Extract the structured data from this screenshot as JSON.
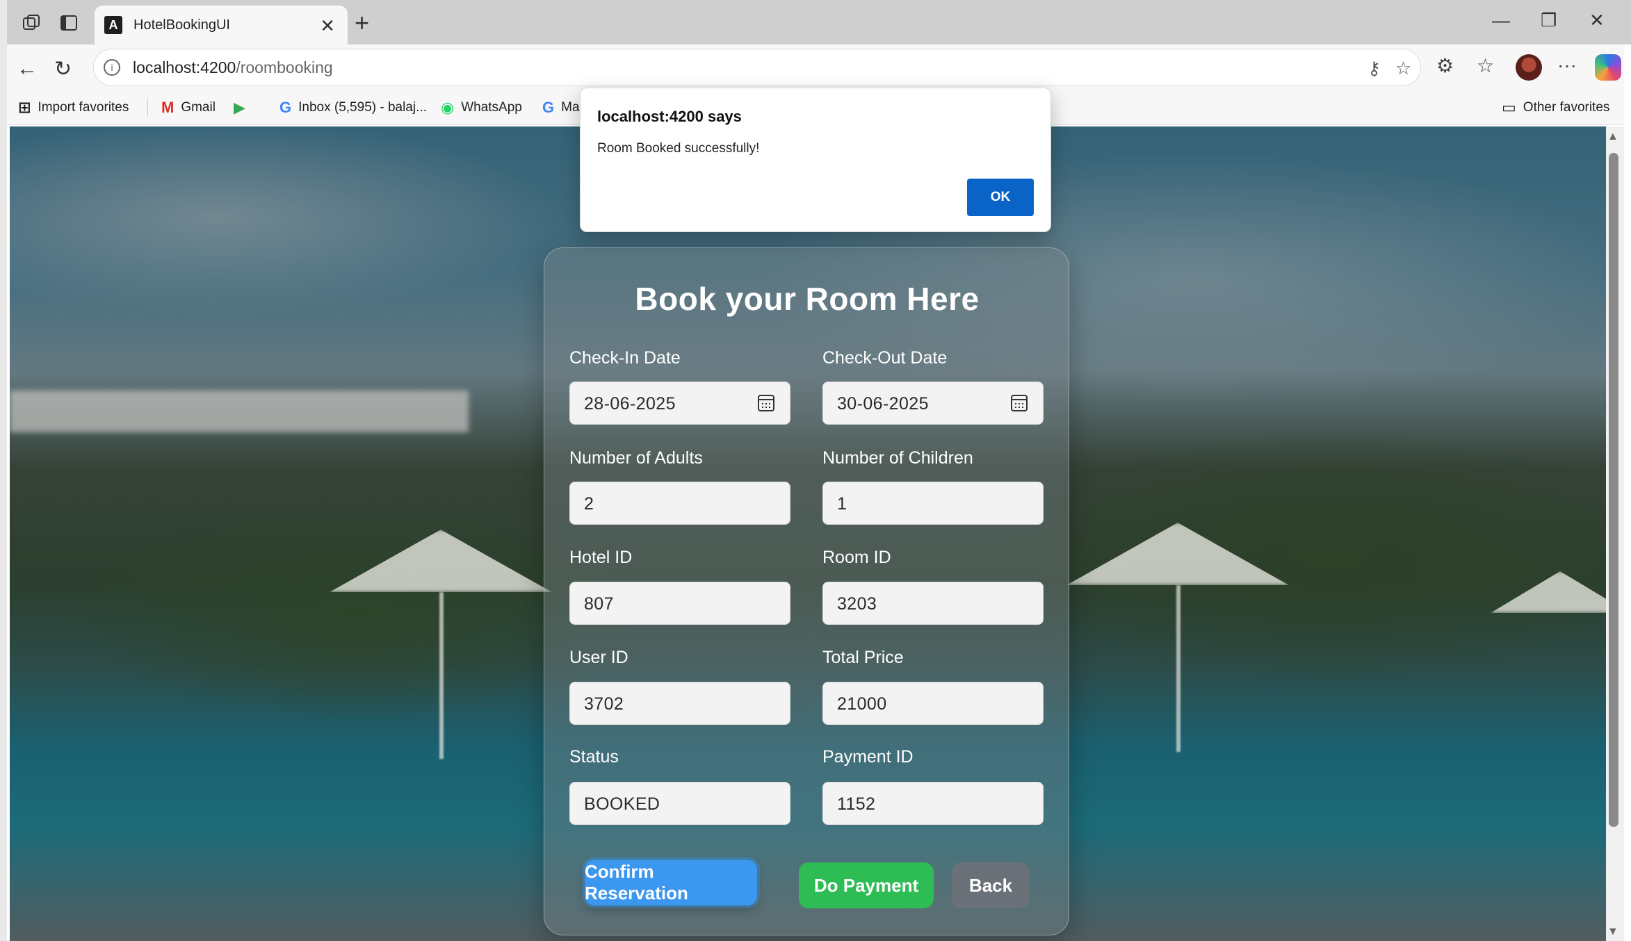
{
  "browser": {
    "tab_title": "HotelBookingUI",
    "favicon": "A",
    "tab_close": "✕",
    "new_tab": "+",
    "url_host": "localhost:4200",
    "url_path": "/roombooking",
    "window_controls": {
      "minimize": "—",
      "restore": "❐",
      "close": "✕"
    },
    "toolbar_icons": {
      "back": "←",
      "reload": "↻",
      "key": "⚷",
      "star": "☆",
      "extensions": "⚙",
      "favorites": "☆",
      "more": "···"
    }
  },
  "favorites_bar": {
    "items": [
      {
        "icon": "⊞",
        "label": "Import favorites"
      },
      {
        "icon": "M",
        "label": "Gmail"
      },
      {
        "icon": "▶",
        "label": ""
      },
      {
        "icon": "G",
        "label": "Inbox (5,595) - balaj..."
      },
      {
        "icon": "◉",
        "label": "WhatsApp"
      },
      {
        "icon": "G",
        "label": "Ma"
      }
    ],
    "other_favorites": "Other favorites",
    "folder_icon": "▭"
  },
  "dialog": {
    "title": "localhost:4200 says",
    "message": "Room Booked successfully!",
    "ok_label": "OK"
  },
  "form": {
    "title": "Book your Room Here",
    "fields": {
      "checkin_label": "Check-In Date",
      "checkin_value": "28-06-2025",
      "checkout_label": "Check-Out Date",
      "checkout_value": "30-06-2025",
      "adults_label": "Number of Adults",
      "adults_value": "2",
      "children_label": "Number of Children",
      "children_value": "1",
      "hotel_label": "Hotel ID",
      "hotel_value": "807",
      "room_label": "Room ID",
      "room_value": "3203",
      "user_label": "User ID",
      "user_value": "3702",
      "price_label": "Total Price",
      "price_value": "21000",
      "status_label": "Status",
      "status_value": "BOOKED",
      "payment_label": "Payment ID",
      "payment_value": "1152"
    },
    "buttons": {
      "confirm": "Confirm Reservation",
      "pay": "Do Payment",
      "back": "Back"
    }
  },
  "colors": {
    "confirm": "#3b97f0",
    "pay": "#2ebd55",
    "back": "#6b7178",
    "dialog_ok": "#0a64c8"
  }
}
